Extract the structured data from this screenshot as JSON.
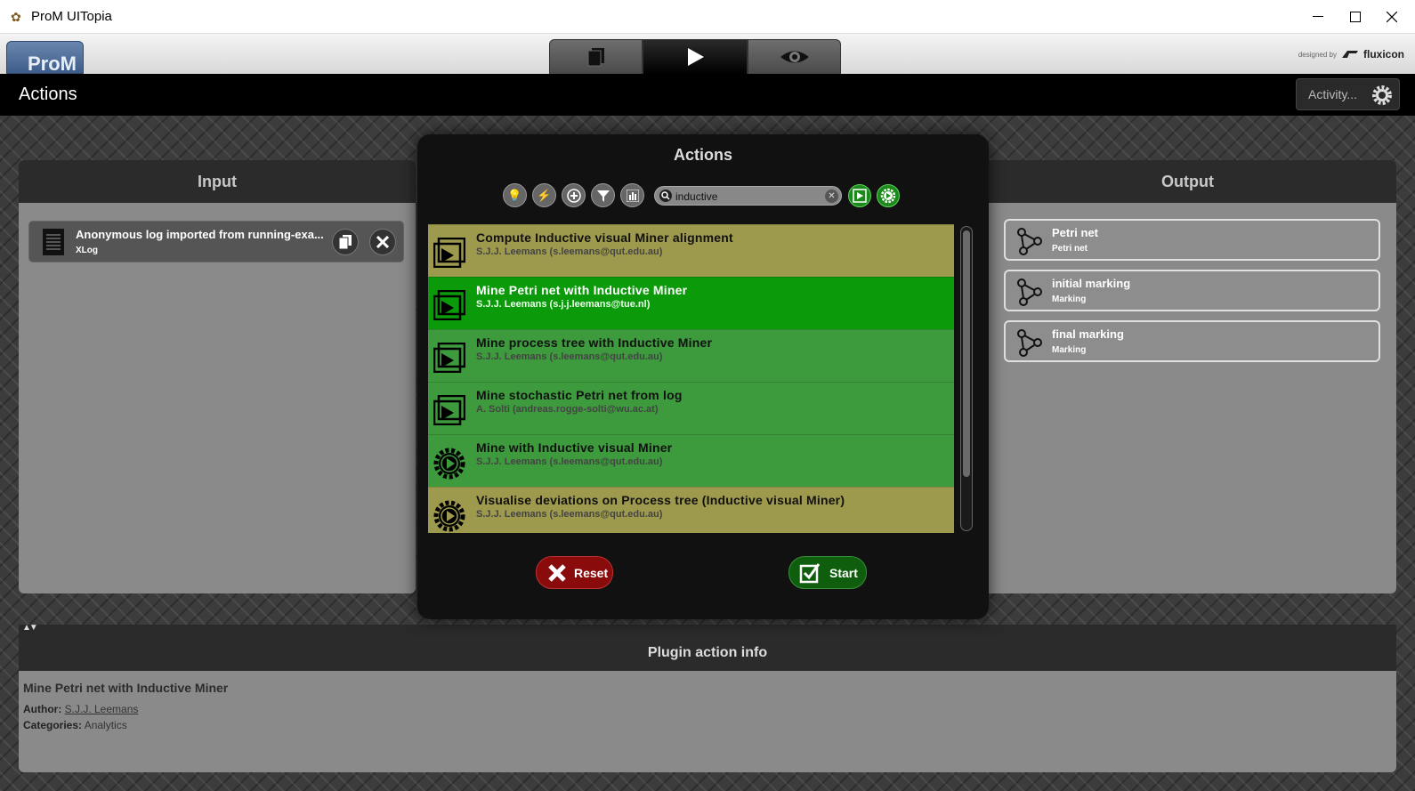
{
  "window": {
    "title": "ProM UITopia",
    "app_icon": "prom-icon",
    "controls": [
      "minimize",
      "maximize",
      "close"
    ]
  },
  "appbar": {
    "logo": "ProM",
    "tabs": [
      {
        "icon": "workspace-icon"
      },
      {
        "icon": "play-icon",
        "active": true
      },
      {
        "icon": "eye-icon"
      }
    ],
    "designed_by": "designed by",
    "brand": "fluxicon"
  },
  "actions_bar": {
    "title": "Actions",
    "activity_label": "Activity..."
  },
  "input_panel": {
    "title": "Input",
    "items": [
      {
        "name": "Anonymous log imported from running-exa...",
        "type": "XLog"
      }
    ]
  },
  "output_panel": {
    "title": "Output",
    "items": [
      {
        "name": "Petri net",
        "type": "Petri net"
      },
      {
        "name": "initial marking",
        "type": "Marking"
      },
      {
        "name": "final marking",
        "type": "Marking"
      }
    ]
  },
  "dialog": {
    "title": "Actions",
    "search": {
      "value": "inductive",
      "placeholder": ""
    },
    "actions": [
      {
        "name": "Compute Inductive visual Miner alignment",
        "author": "S.J.J. Leemans (s.leemans@qut.edu.au)",
        "style": "olive",
        "icon": "plugin-icon"
      },
      {
        "name": "Mine Petri net with Inductive Miner",
        "author": "S.J.J. Leemans (s.j.j.leemans@tue.nl)",
        "style": "selected",
        "icon": "plugin-icon"
      },
      {
        "name": "Mine process tree with Inductive Miner",
        "author": "S.J.J. Leemans (s.leemans@qut.edu.au)",
        "style": "green",
        "icon": "plugin-icon"
      },
      {
        "name": "Mine stochastic Petri net from log",
        "author": "A. Solti (andreas.rogge-solti@wu.ac.at)",
        "style": "green",
        "icon": "plugin-icon"
      },
      {
        "name": "Mine with Inductive visual Miner",
        "author": "S.J.J. Leemans (s.leemans@qut.edu.au)",
        "style": "green",
        "icon": "visualizer-icon"
      },
      {
        "name": "Visualise deviations on Process tree (Inductive visual Miner)",
        "author": "S.J.J. Leemans (s.leemans@qut.edu.au)",
        "style": "olive",
        "icon": "visualizer-icon"
      }
    ],
    "reset_label": "Reset",
    "start_label": "Start"
  },
  "info_panel": {
    "title": "Plugin action info",
    "plugin_name": "Mine Petri net with Inductive Miner",
    "author_label": "Author:",
    "author": "S.J.J. Leemans",
    "categories_label": "Categories:",
    "categories": "Analytics"
  },
  "colors": {
    "selected": "#0a9a0a",
    "green": "#3d9a3d",
    "olive": "#9e9a4d",
    "reset": "#8a0b0b",
    "start": "#0e5e0e"
  }
}
